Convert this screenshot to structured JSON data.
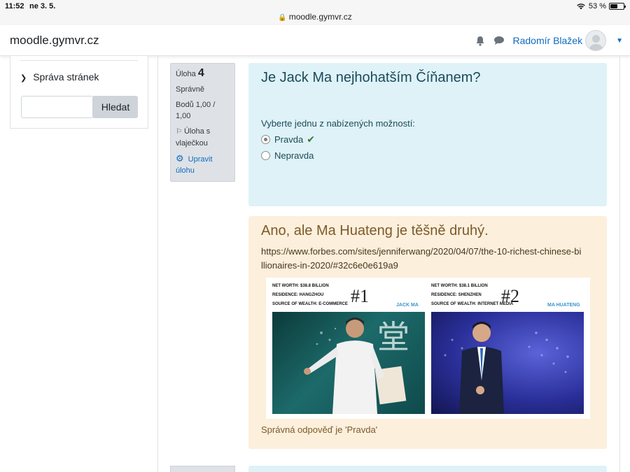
{
  "status_bar": {
    "time": "11:52",
    "date": "ne 3. 5.",
    "battery_percent_label": "53 %",
    "battery_level": 0.53
  },
  "browser": {
    "url": "moodle.gymvr.cz"
  },
  "navbar": {
    "brand": "moodle.gymvr.cz",
    "user_name": "Radomír Blažek"
  },
  "sidebar": {
    "item_label": "Správa stránek",
    "search_placeholder": "",
    "search_button": "Hledat"
  },
  "question_info": {
    "label": "Úloha",
    "number": "4",
    "state": "Správně",
    "points": "Bodů 1,00 / 1,00",
    "flag_label": "Úloha s vlaječkou",
    "edit_label": "Upravit úlohu"
  },
  "question": {
    "text": "Je Jack Ma nejhohatším Číňanem?",
    "prompt": "Vyberte jednu z nabízených možností:",
    "options": [
      {
        "label": "Pravda",
        "selected": true,
        "correct": true
      },
      {
        "label": "Nepravda",
        "selected": false,
        "correct": false
      }
    ]
  },
  "feedback": {
    "title": "Ano, ale Ma Huateng je těšně druhý.",
    "link": "https://www.forbes.com/sites/jenniferwang/2020/04/07/the-10-richest-chinese-billionaires-in-2020/#32c6e0e619a9",
    "right_answer": "Správná odpověď je 'Pravda'",
    "image": {
      "left": {
        "meta": [
          "NET WORTH: $38.8 BILLION",
          "RESIDENCE: HANGZHOU",
          "SOURCE OF WEALTH: E-COMMERCE"
        ],
        "rank": "#1",
        "name": "JACK MA"
      },
      "right": {
        "meta": [
          "NET WORTH: $38.1 BILLION",
          "RESIDENCE: SHENZHEN",
          "SOURCE OF WEALTH: INTERNET MEDIA"
        ],
        "rank": "#2",
        "name": "MA HUATENG"
      }
    }
  },
  "colors": {
    "link": "#0f6cbf",
    "question_bg": "#def2f8",
    "feedback_bg": "#fcefdc",
    "correct": "#357a32"
  }
}
